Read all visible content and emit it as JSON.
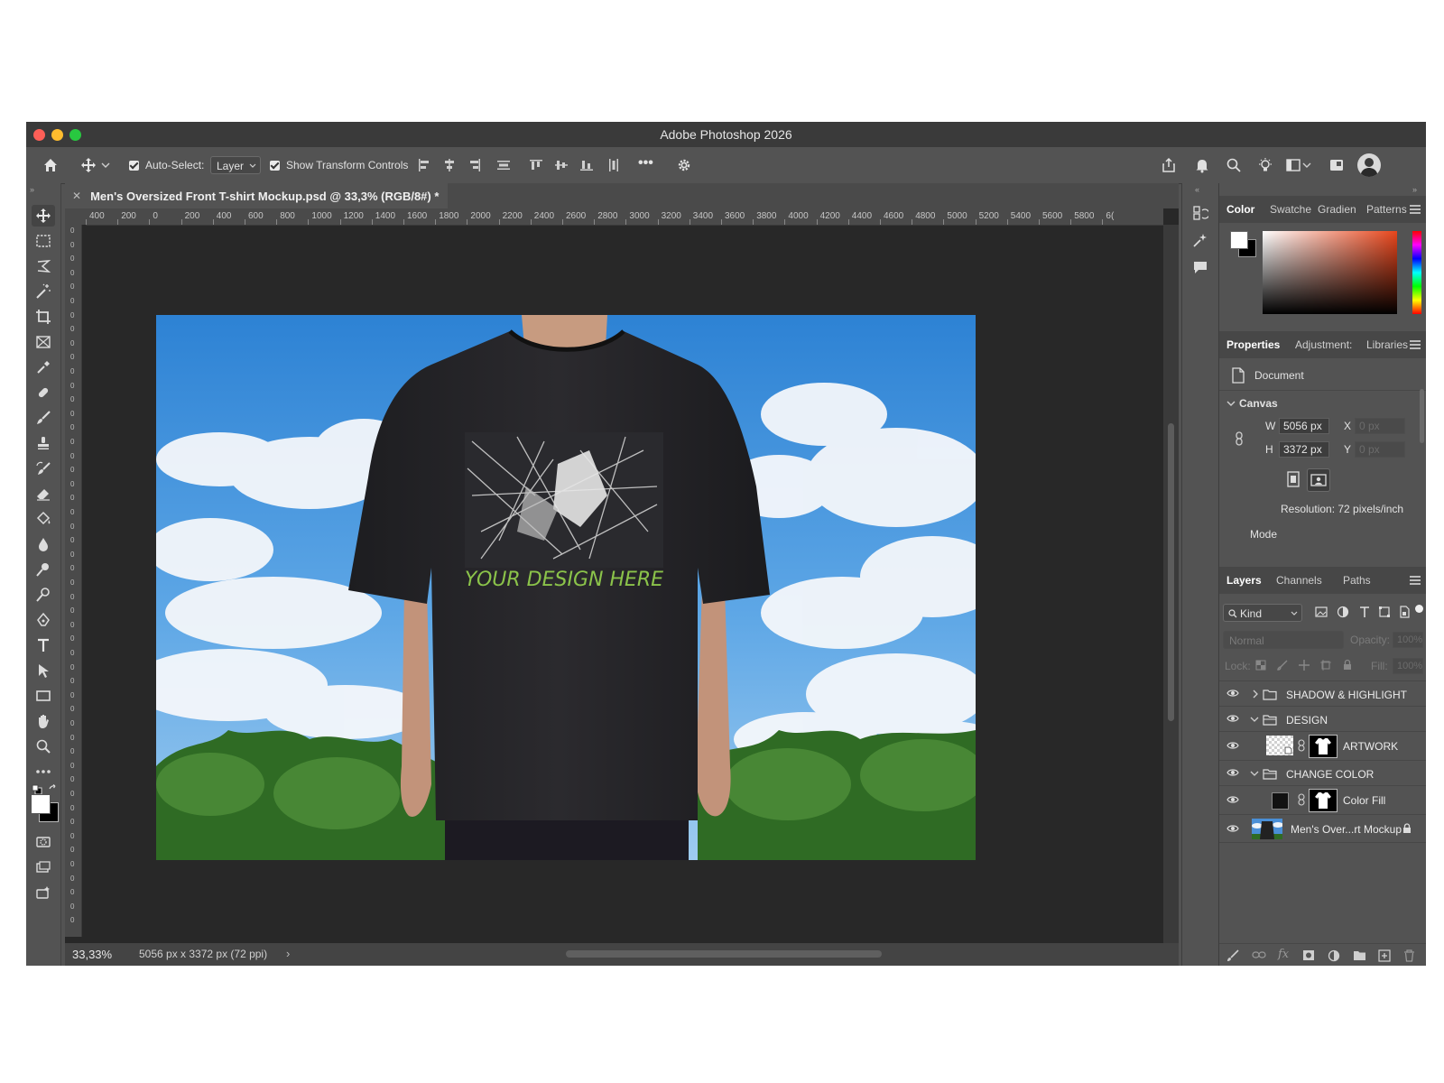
{
  "window": {
    "title": "Adobe Photoshop 2026"
  },
  "options_bar": {
    "auto_select_label": "Auto-Select:",
    "auto_select_checked": true,
    "auto_select_target": "Layer",
    "show_transform_label": "Show Transform Controls",
    "show_transform_checked": true,
    "more_label": "•••"
  },
  "document": {
    "tab_title": "Men's Oversized Front T-shirt Mockup.psd @ 33,3% (RGB/8#) *",
    "zoom": "33,33%",
    "info": "5056 px x 3372 px (72 ppi)",
    "artwork_caption": "YOUR DESIGN HERE"
  },
  "rulers": {
    "horizontal": [
      "400",
      "200",
      "0",
      "200",
      "400",
      "600",
      "800",
      "1000",
      "1200",
      "1400",
      "1600",
      "1800",
      "2000",
      "2200",
      "2400",
      "2600",
      "2800",
      "3000",
      "3200",
      "3400",
      "3600",
      "3800",
      "4000",
      "4200",
      "4400",
      "4600",
      "4800",
      "5000",
      "5200",
      "5400",
      "5600",
      "5800",
      "6("
    ],
    "vertical": [
      "0",
      "0",
      "0",
      "0",
      "0",
      "0",
      "0",
      "0",
      "0",
      "0",
      "0",
      "0",
      "0",
      "0",
      "0",
      "0",
      "0",
      "0",
      "0",
      "0",
      "0",
      "0",
      "0",
      "0",
      "0",
      "0",
      "0",
      "0",
      "0",
      "0",
      "0",
      "0",
      "0",
      "0",
      "0",
      "0",
      "0",
      "0",
      "0",
      "0",
      "0",
      "0",
      "0",
      "0",
      "0",
      "0",
      "0",
      "0",
      "0",
      "0"
    ]
  },
  "color_panel": {
    "tabs": [
      "Color",
      "Swatche",
      "Gradien",
      "Patterns"
    ],
    "active_tab": "Color",
    "foreground": "#ffffff",
    "background": "#000000",
    "hue_color": "#e8461c"
  },
  "properties_panel": {
    "tabs": [
      "Properties",
      "Adjustment:",
      "Libraries"
    ],
    "active_tab": "Properties",
    "doc_label": "Document",
    "canvas_label": "Canvas",
    "w_label": "W",
    "w_value": "5056 px",
    "h_label": "H",
    "h_value": "3372 px",
    "x_label": "X",
    "x_placeholder": "0 px",
    "y_label": "Y",
    "y_placeholder": "0 px",
    "resolution": "Resolution: 72 pixels/inch",
    "mode_label": "Mode"
  },
  "layers_panel": {
    "tabs": [
      "Layers",
      "Channels",
      "Paths"
    ],
    "active_tab": "Layers",
    "filter_label": "Kind",
    "blend_mode": "Normal",
    "opacity_label": "Opacity:",
    "opacity_value": "100%",
    "lock_label": "Lock:",
    "fill_label": "Fill:",
    "fill_value": "100%",
    "layers": [
      {
        "name": "SHADOW & HIGHLIGHT",
        "type": "group",
        "expanded": false
      },
      {
        "name": "DESIGN",
        "type": "group",
        "expanded": true
      },
      {
        "name": "ARTWORK",
        "type": "smart-object-with-mask"
      },
      {
        "name": "CHANGE COLOR",
        "type": "group",
        "expanded": true
      },
      {
        "name": "Color Fill",
        "type": "fill-with-mask"
      },
      {
        "name": "Men's Over...rt Mockup",
        "type": "background-locked"
      }
    ]
  }
}
